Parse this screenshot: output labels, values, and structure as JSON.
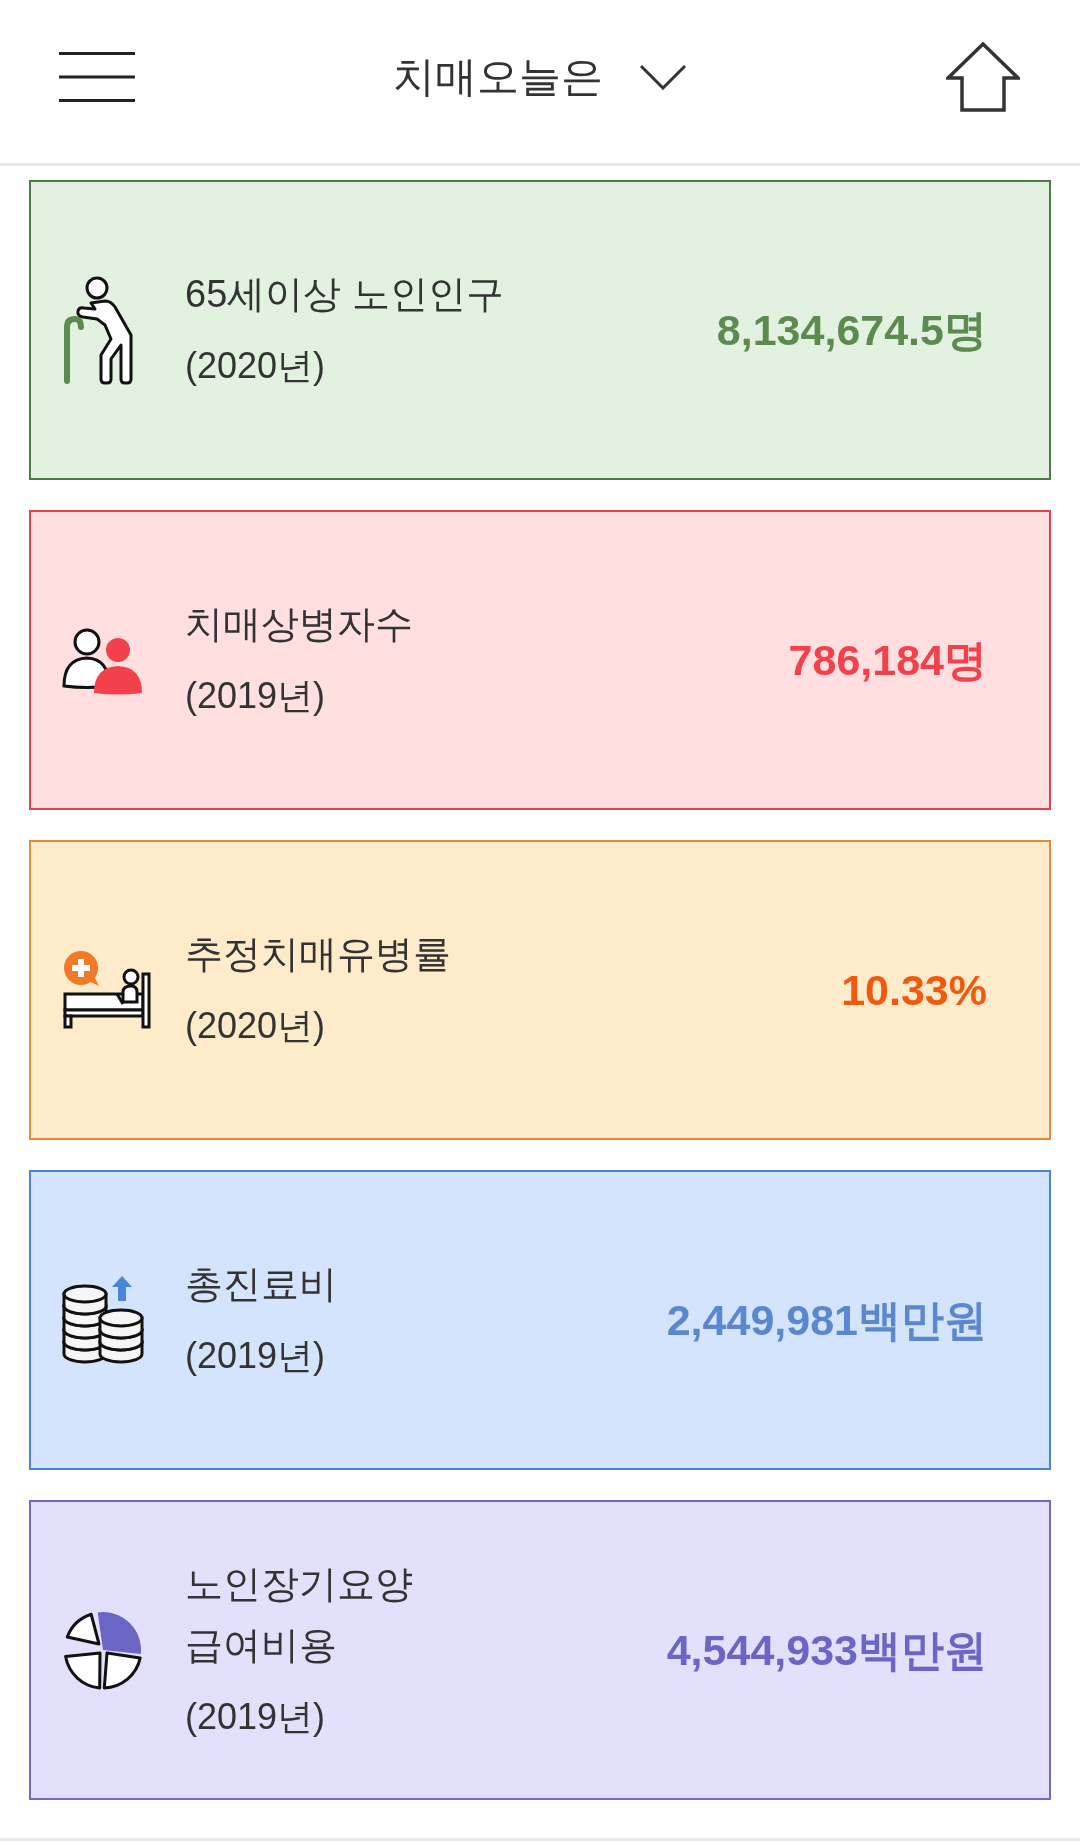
{
  "header": {
    "title": "치매오늘은"
  },
  "stats": [
    {
      "kind": "elderly",
      "title": "65세이상 노인인구",
      "year": "(2020년)",
      "value": "8,134,674.5명",
      "color": "#5b8b4f"
    },
    {
      "kind": "patients",
      "title": "치매상병자수",
      "year": "(2019년)",
      "value": "786,184명",
      "color": "#f2414b"
    },
    {
      "kind": "prevalence",
      "title": "추정치매유병률",
      "year": "(2020년)",
      "value": "10.33%",
      "color": "#f05a0f"
    },
    {
      "kind": "cost",
      "title": "총진료비",
      "year": "(2019년)",
      "value": "2,449,981백만원",
      "color": "#5b87cf"
    },
    {
      "kind": "care",
      "title": "노인장기요양\n급여비용",
      "year": "(2019년)",
      "value": "4,544,933백만원",
      "color": "#6b66c6"
    }
  ]
}
